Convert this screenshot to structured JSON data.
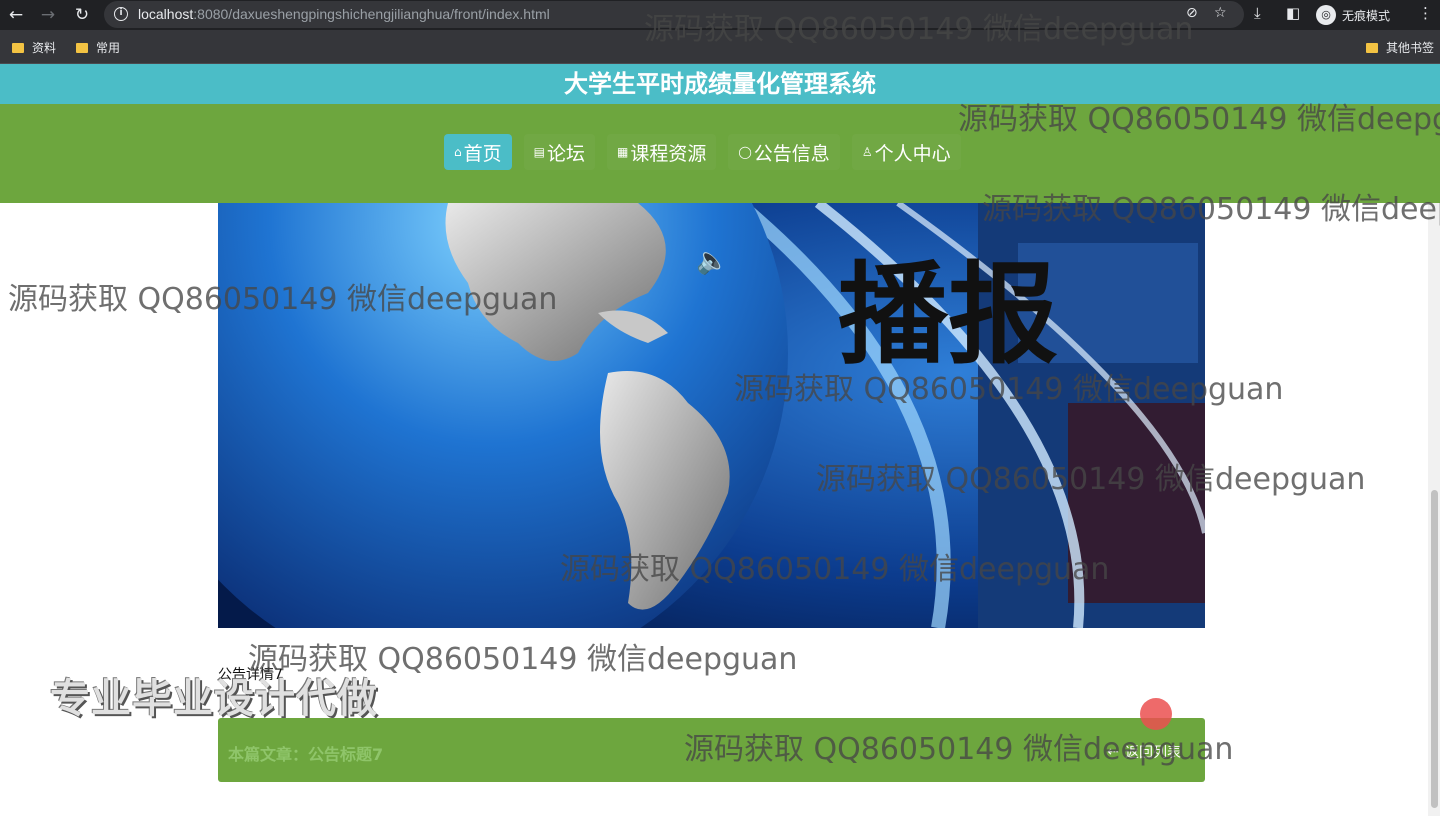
{
  "browser": {
    "url_host": "localhost",
    "url_path": ":8080/daxueshengpingshichengjilianghua/front/index.html",
    "incognito_label": "无痕模式",
    "bookmarks": [
      "资料",
      "常用"
    ],
    "other_bookmarks": "其他书签"
  },
  "site": {
    "title": "大学生平时成绩量化管理系统",
    "menu": [
      {
        "icon": "⌂",
        "label": "首页"
      },
      {
        "icon": "▤",
        "label": "论坛"
      },
      {
        "icon": "▦",
        "label": "课程资源"
      },
      {
        "icon": "◯",
        "label": "公告信息"
      },
      {
        "icon": "♙",
        "label": "个人中心"
      }
    ]
  },
  "banner": {
    "caption": "播报"
  },
  "detail": {
    "label": "公告详情7",
    "article": "本篇文章：公告标题7",
    "back": "返回列表",
    "back_icon": "⇠"
  },
  "overlay": {
    "promo": "专业毕业设计代做",
    "watermark": "源码获取 QQ86050149 微信deepguan"
  },
  "colors": {
    "title_bar": "#4bbdc7",
    "nav_bar": "#6da63e",
    "active_menu": "#4bbdc7"
  }
}
